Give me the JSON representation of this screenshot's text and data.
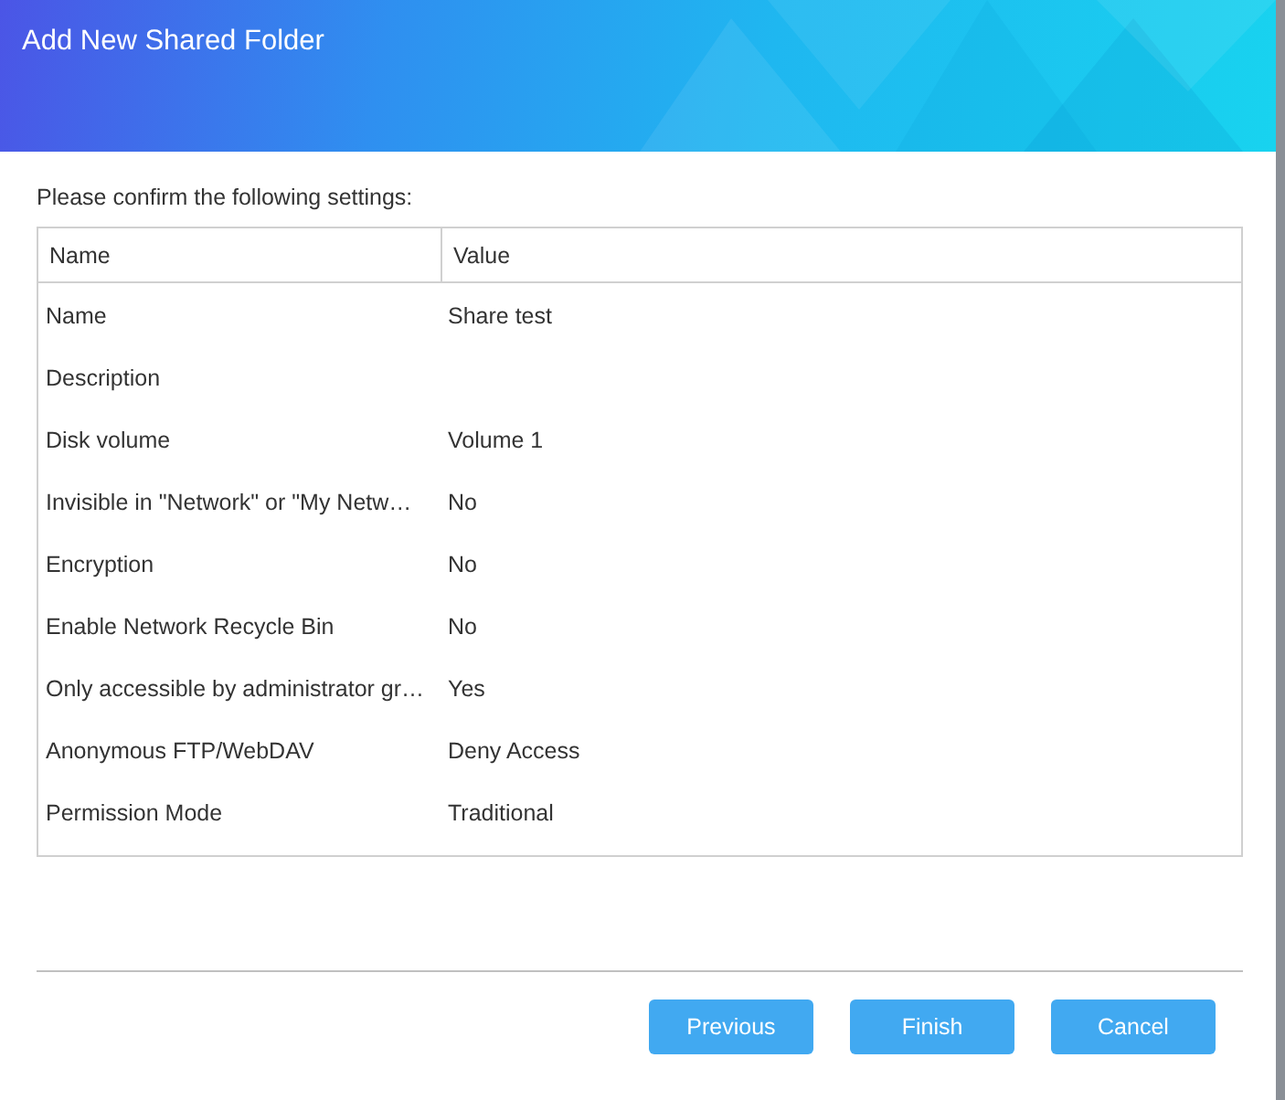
{
  "window": {
    "title": "Add New Shared Folder"
  },
  "instruction": "Please confirm the following settings:",
  "table": {
    "columns": [
      "Name",
      "Value"
    ],
    "rows": [
      {
        "name": "Name",
        "value": "Share test"
      },
      {
        "name": "Description",
        "value": ""
      },
      {
        "name": "Disk volume",
        "value": "Volume 1"
      },
      {
        "name": "Invisible in \"Network\" or \"My Netw…",
        "value": "No"
      },
      {
        "name": "Encryption",
        "value": "No"
      },
      {
        "name": "Enable Network Recycle Bin",
        "value": "No"
      },
      {
        "name": "Only accessible by administrator gr…",
        "value": "Yes"
      },
      {
        "name": "Anonymous FTP/WebDAV",
        "value": "Deny Access"
      },
      {
        "name": "Permission Mode",
        "value": "Traditional"
      }
    ]
  },
  "buttons": [
    "Previous",
    "Finish",
    "Cancel"
  ]
}
